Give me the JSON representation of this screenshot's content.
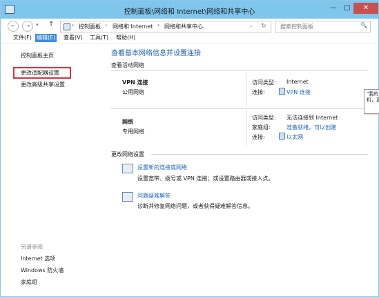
{
  "window": {
    "title": "控制面板\\网络和 Internet\\网络和共享中心",
    "min_glyph": "—",
    "max_glyph": "□",
    "close_glyph": "✕"
  },
  "nav": {
    "back_glyph": "←",
    "forward_glyph": "→",
    "dropdown_glyph": "▾",
    "up_glyph": "↑",
    "breadcrumbs": [
      "控制面板",
      "网络和 Internet",
      "网络和共享中心"
    ],
    "sep_glyph": "›",
    "addr_dropdown_glyph": "⌄",
    "refresh_glyph": "↻",
    "search_placeholder": "搜索控制面板",
    "search_glyph": "🔍"
  },
  "menu": {
    "items": [
      "文件(F)",
      "编辑(E)",
      "查看(V)",
      "工具(T)",
      "帮助(H)"
    ],
    "active_index": 1
  },
  "sidebar": {
    "links": [
      "控制面板主页",
      "更改适配器设置",
      "更改高级共享设置"
    ],
    "see_also_label": "另请参阅",
    "see_also_links": [
      "Internet 选项",
      "Windows 防火墙",
      "家庭组"
    ]
  },
  "main": {
    "heading": "查看基本网络信息并设置连接",
    "active_networks_label": "查看活动网络",
    "networks": [
      {
        "name": "VPN 连接",
        "type": "公用网络",
        "access_type_label": "访问类型:",
        "access_type_value": "Internet",
        "connection_label": "连接:",
        "connection_value": "VPN 连接"
      },
      {
        "name": "网络",
        "type": "专用网络",
        "access_type_label": "访问类型:",
        "access_type_value": "无法连接到 Internet",
        "homegroup_label": "家庭组:",
        "homegroup_value": "准备就绪，可以创建",
        "connection_label": "连接:",
        "connection_value": "以太网"
      }
    ],
    "change_settings_label": "更改网络设置",
    "tasks": [
      {
        "title": "设置新的连接或网络",
        "desc": "设置宽带、拨号或 VPN 连接；或设置路由器或接入点。"
      },
      {
        "title": "问题疑难解答",
        "desc": "诊断并修复网络问题，或者获得疑难解答信息。"
      }
    ]
  },
  "tooltip": {
    "line1": "\"我的",
    "line2": "机，直"
  }
}
